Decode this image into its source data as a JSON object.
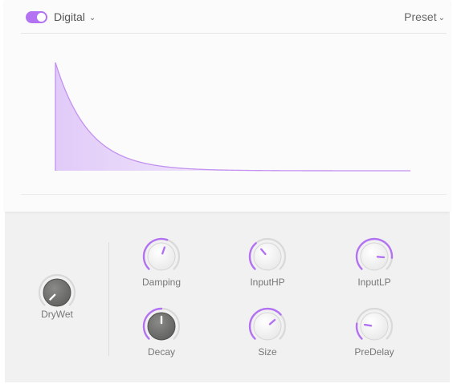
{
  "header": {
    "toggle_on": true,
    "mode_label": "Digital",
    "mode_chevron_icon": "chevron-down-icon",
    "preset_label": "Preset",
    "preset_chevron_icon": "chevron-down-icon"
  },
  "colors": {
    "accent": "#b372f2",
    "curve": "#c391f0",
    "knob_light": "#f6f6f6",
    "knob_dark": "#6e6e6c",
    "panel_bg": "#fbfbfb",
    "controls_bg": "#f1f1f1"
  },
  "envelope": {
    "shape": "exponential-decay"
  },
  "knobs": [
    {
      "id": "drywet",
      "label": "DryWet",
      "value": 0.0,
      "style": "dark"
    },
    {
      "id": "damping",
      "label": "Damping",
      "value": 0.57,
      "style": "light"
    },
    {
      "id": "inputhp",
      "label": "InputHP",
      "value": 0.35,
      "style": "light"
    },
    {
      "id": "inputlp",
      "label": "InputLP",
      "value": 0.85,
      "style": "light"
    },
    {
      "id": "decay",
      "label": "Decay",
      "value": 0.5,
      "style": "dark"
    },
    {
      "id": "size",
      "label": "Size",
      "value": 0.68,
      "style": "light"
    },
    {
      "id": "predelay",
      "label": "PreDelay",
      "value": 0.2,
      "style": "light"
    }
  ]
}
